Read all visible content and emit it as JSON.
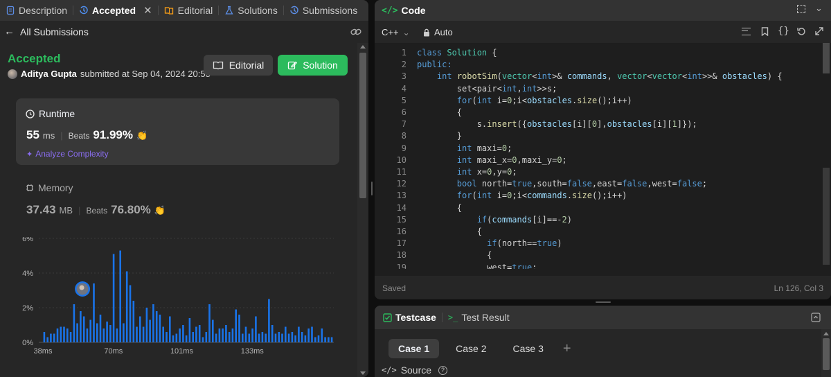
{
  "left_tabs": [
    {
      "label": "Description",
      "icon": "description-icon"
    },
    {
      "label": "Accepted",
      "icon": "history-icon"
    },
    {
      "label": "Editorial",
      "icon": "book-icon"
    },
    {
      "label": "Solutions",
      "icon": "flask-icon"
    },
    {
      "label": "Submissions",
      "icon": "history-icon"
    }
  ],
  "nav": {
    "back_label": "All Submissions"
  },
  "result": {
    "status": "Accepted",
    "user": "Aditya Gupta",
    "submitted_text": "submitted at Sep 04, 2024 20:58",
    "editorial_label": "Editorial",
    "solution_label": "Solution"
  },
  "runtime": {
    "title": "Runtime",
    "value": "55",
    "unit": "ms",
    "beats_label": "Beats",
    "beats_value": "91.99%",
    "analyze_label": "Analyze Complexity"
  },
  "memory": {
    "title": "Memory",
    "value": "37.43",
    "unit": "MB",
    "beats_label": "Beats",
    "beats_value": "76.80%"
  },
  "colors": {
    "accent_green": "#2cbb5d",
    "bar_blue": "#1a73e8",
    "keyword": "#569cd6",
    "type": "#4ec9b0",
    "func": "#dcdcaa",
    "var": "#9cdcfe",
    "number": "#b5cea8"
  },
  "chart_data": {
    "type": "bar",
    "title": "",
    "xlabel": "",
    "ylabel": "",
    "y_tick_labels": [
      "6%",
      "4%",
      "2%",
      "0%"
    ],
    "x_tick_labels": [
      "38ms",
      "70ms",
      "101ms",
      "133ms"
    ],
    "ylim": [
      0,
      6
    ],
    "x_range_ms": [
      38,
      170
    ],
    "values": [
      0.6,
      0.3,
      0.5,
      0.5,
      0.8,
      0.9,
      0.9,
      0.8,
      0.6,
      2.2,
      1.1,
      1.8,
      1.5,
      0.8,
      1.3,
      3.4,
      1.1,
      1.6,
      0.8,
      1.2,
      1.0,
      5.1,
      0.8,
      5.3,
      1.1,
      4.1,
      3.3,
      2.4,
      0.9,
      1.5,
      0.9,
      2.0,
      1.3,
      2.2,
      1.8,
      1.6,
      0.9,
      0.6,
      1.5,
      0.4,
      0.5,
      0.8,
      1.0,
      0.4,
      1.4,
      0.6,
      0.9,
      1.0,
      0.3,
      0.6,
      2.2,
      1.3,
      0.5,
      0.8,
      0.8,
      1.0,
      0.6,
      0.8,
      1.9,
      1.6,
      0.5,
      0.9,
      0.5,
      0.8,
      1.5,
      0.5,
      0.6,
      0.5,
      2.5,
      1.0,
      0.5,
      0.6,
      0.5,
      0.9,
      0.5,
      0.6,
      0.4,
      0.9,
      0.6,
      0.4,
      0.8,
      0.9,
      0.3,
      0.4,
      0.8,
      0.3,
      0.3,
      0.3
    ],
    "highlight_ms": 55,
    "grid": true
  },
  "code_panel": {
    "title": "Code",
    "language": "C++",
    "mode": "Auto",
    "status": "Saved",
    "cursor": "Ln 126, Col 3"
  },
  "code_lines": [
    [
      {
        "t": "class ",
        "c": "kw"
      },
      {
        "t": "Solution",
        "c": "ty"
      },
      {
        "t": " {",
        "c": "p"
      }
    ],
    [
      {
        "t": "public:",
        "c": "kw"
      }
    ],
    [
      {
        "t": "    ",
        "c": "p"
      },
      {
        "t": "int ",
        "c": "kw"
      },
      {
        "t": "robotSim",
        "c": "fn"
      },
      {
        "t": "(",
        "c": "p"
      },
      {
        "t": "vector",
        "c": "ty"
      },
      {
        "t": "<",
        "c": "p"
      },
      {
        "t": "int",
        "c": "kw"
      },
      {
        "t": ">& ",
        "c": "p"
      },
      {
        "t": "commands",
        "c": "va"
      },
      {
        "t": ", ",
        "c": "p"
      },
      {
        "t": "vector",
        "c": "ty"
      },
      {
        "t": "<",
        "c": "p"
      },
      {
        "t": "vector",
        "c": "ty"
      },
      {
        "t": "<",
        "c": "p"
      },
      {
        "t": "int",
        "c": "kw"
      },
      {
        "t": ">>& ",
        "c": "p"
      },
      {
        "t": "obstacles",
        "c": "va"
      },
      {
        "t": ") {",
        "c": "p"
      }
    ],
    [
      {
        "t": "        set<pair<",
        "c": "p"
      },
      {
        "t": "int",
        "c": "kw"
      },
      {
        "t": ",",
        "c": "p"
      },
      {
        "t": "int",
        "c": "kw"
      },
      {
        "t": ">>s;",
        "c": "p"
      }
    ],
    [
      {
        "t": "        ",
        "c": "p"
      },
      {
        "t": "for",
        "c": "kw"
      },
      {
        "t": "(",
        "c": "p"
      },
      {
        "t": "int",
        "c": "kw"
      },
      {
        "t": " i=",
        "c": "p"
      },
      {
        "t": "0",
        "c": "nu"
      },
      {
        "t": ";i<",
        "c": "p"
      },
      {
        "t": "obstacles",
        "c": "va"
      },
      {
        "t": ".",
        "c": "p"
      },
      {
        "t": "size",
        "c": "fn"
      },
      {
        "t": "();i++)",
        "c": "p"
      }
    ],
    [
      {
        "t": "        {",
        "c": "p"
      }
    ],
    [
      {
        "t": "            s.",
        "c": "p"
      },
      {
        "t": "insert",
        "c": "fn"
      },
      {
        "t": "({",
        "c": "p"
      },
      {
        "t": "obstacles",
        "c": "va"
      },
      {
        "t": "[i][",
        "c": "p"
      },
      {
        "t": "0",
        "c": "nu"
      },
      {
        "t": "],",
        "c": "p"
      },
      {
        "t": "obstacles",
        "c": "va"
      },
      {
        "t": "[i][",
        "c": "p"
      },
      {
        "t": "1",
        "c": "nu"
      },
      {
        "t": "]});",
        "c": "p"
      }
    ],
    [
      {
        "t": "        }",
        "c": "p"
      }
    ],
    [
      {
        "t": "        ",
        "c": "p"
      },
      {
        "t": "int",
        "c": "kw"
      },
      {
        "t": " maxi=",
        "c": "p"
      },
      {
        "t": "0",
        "c": "nu"
      },
      {
        "t": ";",
        "c": "p"
      }
    ],
    [
      {
        "t": "        ",
        "c": "p"
      },
      {
        "t": "int",
        "c": "kw"
      },
      {
        "t": " maxi_x=",
        "c": "p"
      },
      {
        "t": "0",
        "c": "nu"
      },
      {
        "t": ",maxi_y=",
        "c": "p"
      },
      {
        "t": "0",
        "c": "nu"
      },
      {
        "t": ";",
        "c": "p"
      }
    ],
    [
      {
        "t": "        ",
        "c": "p"
      },
      {
        "t": "int",
        "c": "kw"
      },
      {
        "t": " x=",
        "c": "p"
      },
      {
        "t": "0",
        "c": "nu"
      },
      {
        "t": ",y=",
        "c": "p"
      },
      {
        "t": "0",
        "c": "nu"
      },
      {
        "t": ";",
        "c": "p"
      }
    ],
    [
      {
        "t": "        ",
        "c": "p"
      },
      {
        "t": "bool",
        "c": "kw"
      },
      {
        "t": " north=",
        "c": "p"
      },
      {
        "t": "true",
        "c": "kw"
      },
      {
        "t": ",south=",
        "c": "p"
      },
      {
        "t": "false",
        "c": "kw"
      },
      {
        "t": ",east=",
        "c": "p"
      },
      {
        "t": "false",
        "c": "kw"
      },
      {
        "t": ",west=",
        "c": "p"
      },
      {
        "t": "false",
        "c": "kw"
      },
      {
        "t": ";",
        "c": "p"
      }
    ],
    [
      {
        "t": "        ",
        "c": "p"
      },
      {
        "t": "for",
        "c": "kw"
      },
      {
        "t": "(",
        "c": "p"
      },
      {
        "t": "int",
        "c": "kw"
      },
      {
        "t": " i=",
        "c": "p"
      },
      {
        "t": "0",
        "c": "nu"
      },
      {
        "t": ";i<",
        "c": "p"
      },
      {
        "t": "commands",
        "c": "va"
      },
      {
        "t": ".",
        "c": "p"
      },
      {
        "t": "size",
        "c": "fn"
      },
      {
        "t": "();i++)",
        "c": "p"
      }
    ],
    [
      {
        "t": "        {",
        "c": "p"
      }
    ],
    [
      {
        "t": "            ",
        "c": "p"
      },
      {
        "t": "if",
        "c": "kw"
      },
      {
        "t": "(",
        "c": "p"
      },
      {
        "t": "commands",
        "c": "va"
      },
      {
        "t": "[i]==-",
        "c": "p"
      },
      {
        "t": "2",
        "c": "nu"
      },
      {
        "t": ")",
        "c": "p"
      }
    ],
    [
      {
        "t": "            {",
        "c": "p"
      }
    ],
    [
      {
        "t": "              ",
        "c": "p"
      },
      {
        "t": "if",
        "c": "kw"
      },
      {
        "t": "(north==",
        "c": "p"
      },
      {
        "t": "true",
        "c": "kw"
      },
      {
        "t": ")",
        "c": "p"
      }
    ],
    [
      {
        "t": "              {",
        "c": "p"
      }
    ],
    [
      {
        "t": "              west=",
        "c": "p"
      },
      {
        "t": "true",
        "c": "kw"
      },
      {
        "t": ";",
        "c": "p"
      }
    ]
  ],
  "line_numbers": [
    "1",
    "2",
    "3",
    "4",
    "5",
    "6",
    "7",
    "8",
    "9",
    "10",
    "11",
    "12",
    "13",
    "14",
    "15",
    "16",
    "17",
    "18",
    "19"
  ],
  "testcase": {
    "tab_label": "Testcase",
    "result_label": "Test Result",
    "cases": [
      "Case 1",
      "Case 2",
      "Case 3"
    ],
    "add_label": "+",
    "source_label": "Source"
  }
}
